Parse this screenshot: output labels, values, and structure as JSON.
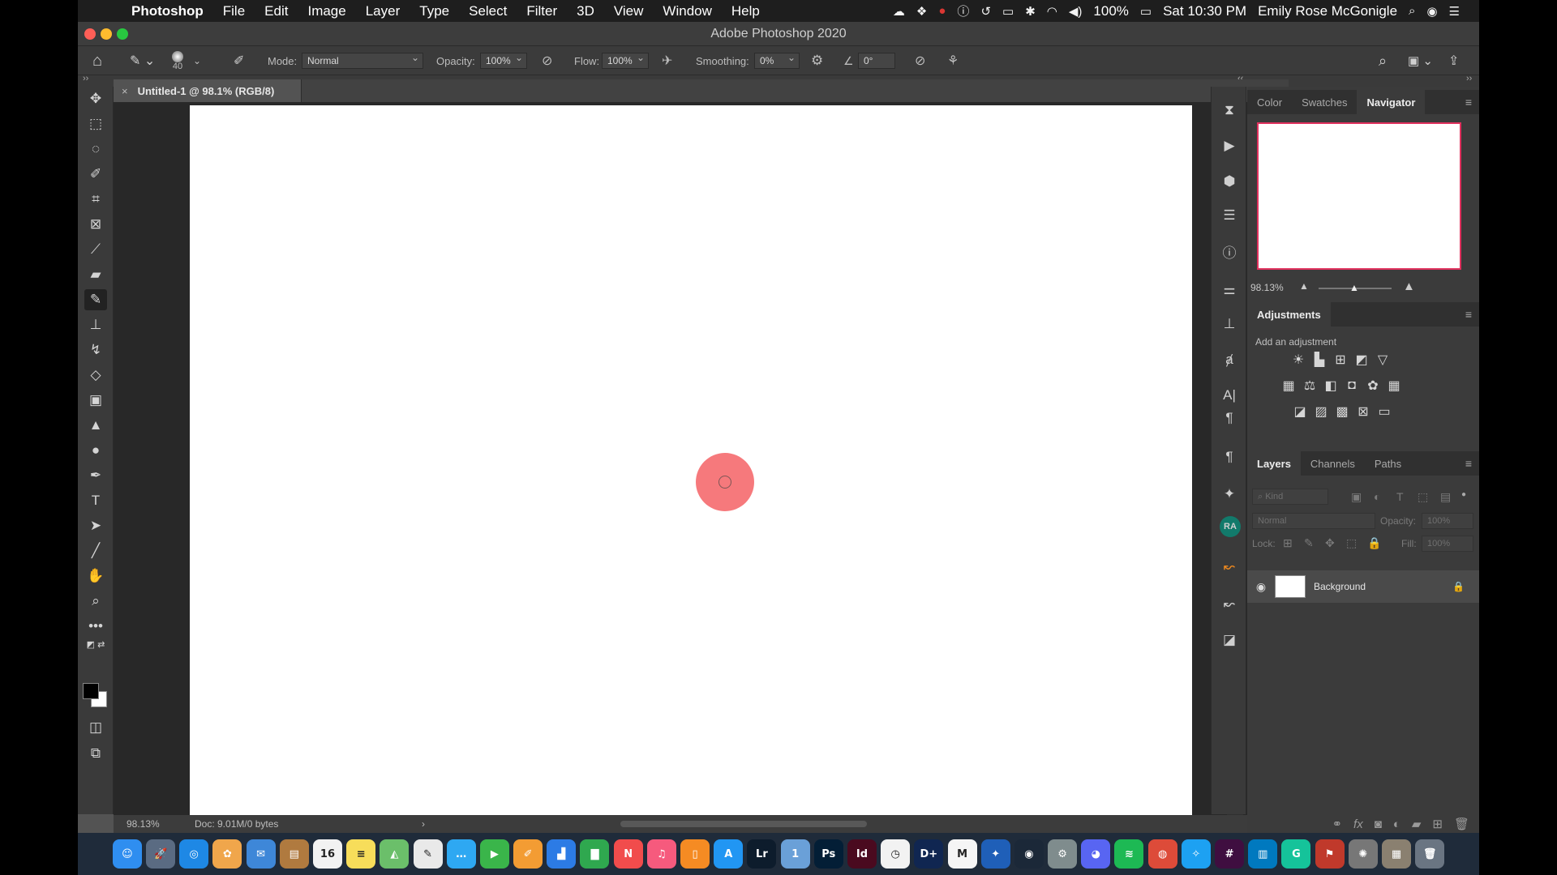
{
  "menubar": {
    "apple_glyph": "",
    "app_name": "Photoshop",
    "menus": [
      "File",
      "Edit",
      "Image",
      "Layer",
      "Type",
      "Select",
      "Filter",
      "3D",
      "View",
      "Window",
      "Help"
    ],
    "battery": "100%",
    "clock": "Sat 10:30 PM",
    "user": "Emily Rose McGonigle"
  },
  "window": {
    "title": "Adobe Photoshop 2020"
  },
  "options_bar": {
    "brush_size": "40",
    "mode_label": "Mode:",
    "mode_value": "Normal",
    "opacity_label": "Opacity:",
    "opacity_value": "100%",
    "flow_label": "Flow:",
    "flow_value": "100%",
    "smoothing_label": "Smoothing:",
    "smoothing_value": "0%",
    "angle_value": "0°"
  },
  "document": {
    "tab_close": "×",
    "tab_title": "Untitled-1 @ 98.1% (RGB/8)",
    "brush_color": "#f6797c"
  },
  "status_bar": {
    "zoom": "98.13%",
    "doc_size": "Doc: 9.01M/0 bytes",
    "arrow": "›"
  },
  "navigator_panel": {
    "tabs": [
      "Color",
      "Swatches",
      "Navigator"
    ],
    "active_tab": "Navigator",
    "zoom": "98.13%",
    "proxy_color": "#e0315e"
  },
  "adjustments_panel": {
    "title": "Adjustments",
    "hint": "Add an adjustment"
  },
  "layers_panel": {
    "tabs": [
      "Layers",
      "Channels",
      "Paths"
    ],
    "filter_placeholder": "Kind",
    "blend_mode": "Normal",
    "opacity_label": "Opacity:",
    "opacity_value": "100%",
    "lock_label": "Lock:",
    "fill_label": "Fill:",
    "fill_value": "100%",
    "layers": [
      {
        "name": "Background",
        "visible": true,
        "locked": true
      }
    ]
  },
  "collapse_glyphs": {
    "left": "››",
    "mid": "‹‹",
    "right": "››"
  },
  "dock_apps": [
    {
      "name": "Finder",
      "label": "☺",
      "color": "#2f8ef0"
    },
    {
      "name": "Launchpad",
      "label": "🚀",
      "color": "#5a6b82"
    },
    {
      "name": "Safari",
      "label": "◎",
      "color": "#1e88e5"
    },
    {
      "name": "Photos",
      "label": "✿",
      "color": "#f0a64b"
    },
    {
      "name": "Mail Stamp",
      "label": "✉",
      "color": "#3e87d8"
    },
    {
      "name": "Notefile",
      "label": "▤",
      "color": "#b07a3f"
    },
    {
      "name": "Calendar",
      "label": "16",
      "color": "#f2f2f2"
    },
    {
      "name": "Notes",
      "label": "≡",
      "color": "#f7dd5a"
    },
    {
      "name": "Maps",
      "label": "◭",
      "color": "#6bbf6a"
    },
    {
      "name": "TextEdit",
      "label": "✎",
      "color": "#e9e9e9"
    },
    {
      "name": "Messages",
      "label": "…",
      "color": "#2ea8f2"
    },
    {
      "name": "FaceTime",
      "label": "▶",
      "color": "#3ab54a"
    },
    {
      "name": "Pages",
      "label": "✐",
      "color": "#f39c33"
    },
    {
      "name": "Keynote",
      "label": "▟",
      "color": "#2c7be5"
    },
    {
      "name": "Numbers",
      "label": "▇",
      "color": "#2fa84f"
    },
    {
      "name": "News",
      "label": "N",
      "color": "#f14c4c"
    },
    {
      "name": "Music",
      "label": "♫",
      "color": "#f65a7d"
    },
    {
      "name": "Books",
      "label": "▯",
      "color": "#f58b23"
    },
    {
      "name": "App Store",
      "label": "A",
      "color": "#2196f3"
    },
    {
      "name": "Lightroom",
      "label": "Lr",
      "color": "#0d1c2c"
    },
    {
      "name": "1Password",
      "label": "1",
      "color": "#6aa0d8"
    },
    {
      "name": "Photoshop",
      "label": "Ps",
      "color": "#031e36"
    },
    {
      "name": "InDesign",
      "label": "Id",
      "color": "#4a0a1f"
    },
    {
      "name": "Clock",
      "label": "◷",
      "color": "#f2f2f2"
    },
    {
      "name": "Disney+",
      "label": "D+",
      "color": "#102651"
    },
    {
      "name": "Medium",
      "label": "M",
      "color": "#f5f5f5"
    },
    {
      "name": "Xcode",
      "label": "✦",
      "color": "#1f5fb8"
    },
    {
      "name": "Steam",
      "label": "◉",
      "color": "#1b2838"
    },
    {
      "name": "System Preferences",
      "label": "⚙",
      "color": "#7f8c8d"
    },
    {
      "name": "Discord",
      "label": "◕",
      "color": "#5865f2"
    },
    {
      "name": "Spotify",
      "label": "≋",
      "color": "#1db954"
    },
    {
      "name": "Chrome",
      "label": "◍",
      "color": "#dd4b39"
    },
    {
      "name": "Twitter",
      "label": "✧",
      "color": "#1da1f2"
    },
    {
      "name": "Slack",
      "label": "#",
      "color": "#3f0e40"
    },
    {
      "name": "Trello",
      "label": "▥",
      "color": "#0079bf"
    },
    {
      "name": "Grammarly",
      "label": "G",
      "color": "#15c39a"
    },
    {
      "name": "Flag",
      "label": "⚑",
      "color": "#c0392b"
    },
    {
      "name": "Gyroflow",
      "label": "✺",
      "color": "#777"
    },
    {
      "name": "Preview",
      "label": "▦",
      "color": "#8a8070"
    },
    {
      "name": "Trash",
      "label": "🗑",
      "color": "#6a7582"
    }
  ]
}
